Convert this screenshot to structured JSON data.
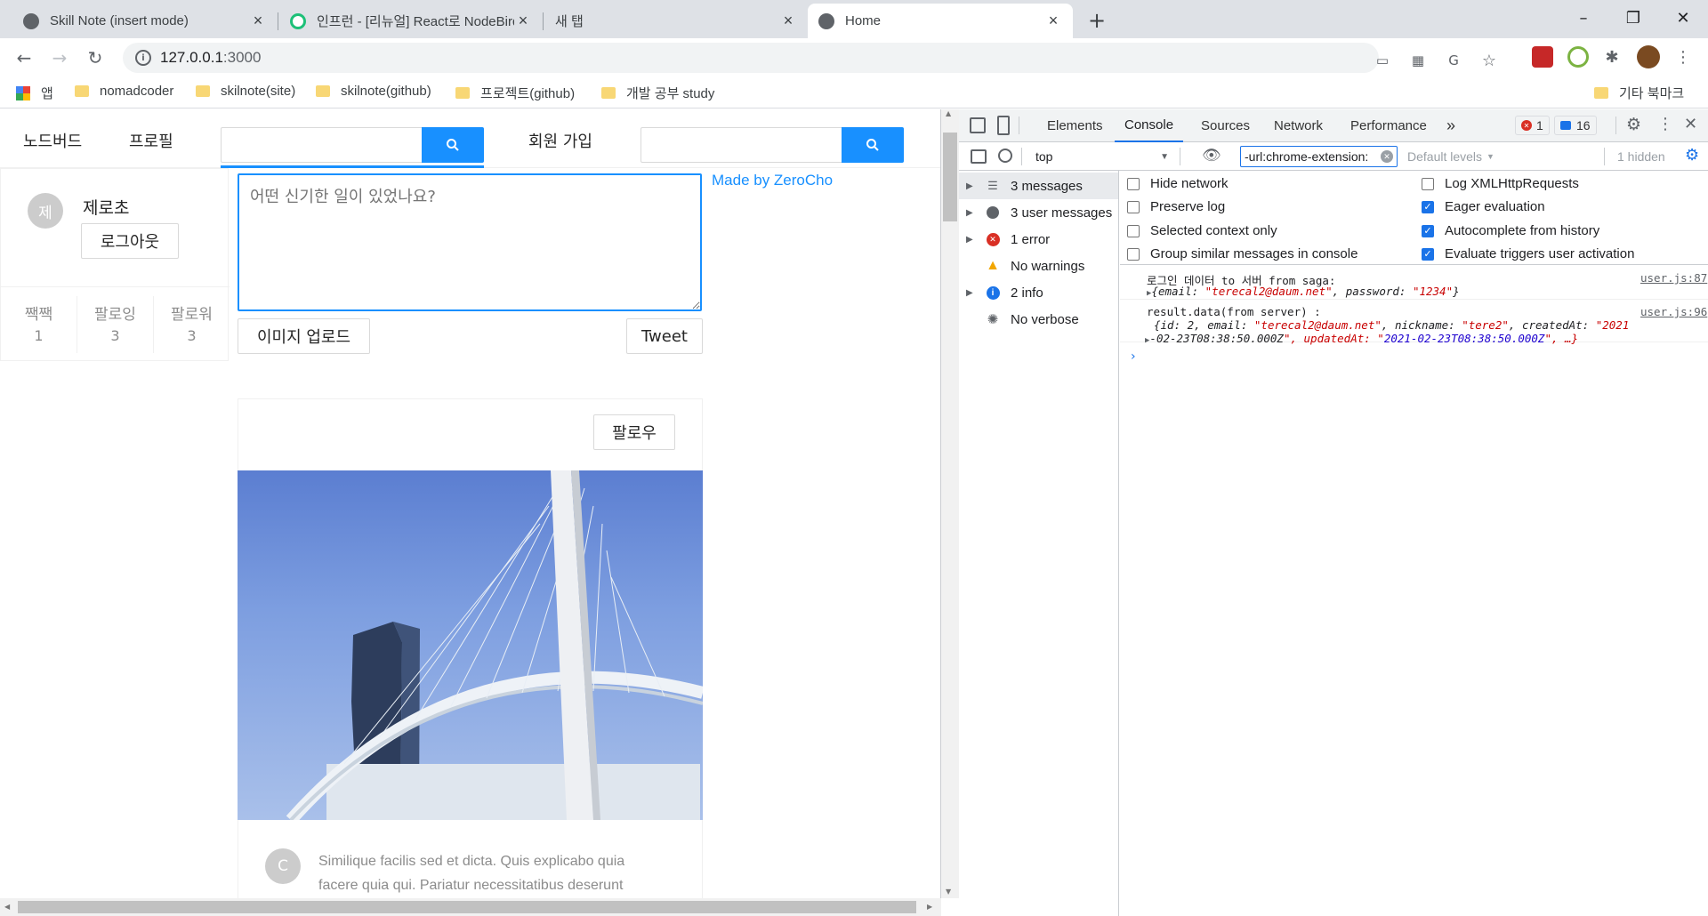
{
  "browser": {
    "tabs": [
      {
        "title": "Skill Note (insert mode)",
        "active": false
      },
      {
        "title": "인프런 - [리뉴얼] React로 NodeBird",
        "active": false
      },
      {
        "title": "새 탭",
        "active": false
      },
      {
        "title": "Home",
        "active": true
      }
    ],
    "url_host": "127.0.0.1",
    "url_port": ":3000",
    "bookmarks": {
      "apps": "앱",
      "items": [
        "nomadcoder",
        "skilnote(site)",
        "skilnote(github)",
        "프로젝트(github)",
        "개발 공부 study"
      ],
      "other": "기타 북마크"
    }
  },
  "app": {
    "menu": {
      "home": "노드버드",
      "profile": "프로필",
      "signup": "회원 가입"
    },
    "user": {
      "avatar_letter": "제",
      "nickname": "제로초",
      "logout_label": "로그아웃"
    },
    "stats": [
      {
        "label": "짹짹",
        "value": "1"
      },
      {
        "label": "팔로잉",
        "value": "3"
      },
      {
        "label": "팔로워",
        "value": "3"
      }
    ],
    "post_form": {
      "placeholder": "어떤 신기한 일이 있었나요?",
      "upload_label": "이미지 업로드",
      "tweet_label": "Tweet"
    },
    "made_by": "Made by ZeroCho",
    "post": {
      "follow_label": "팔로우",
      "author_letter": "C",
      "content_line1": "Similique facilis sed et dicta. Quis explicabo quia",
      "content_line2": "facere quia qui. Pariatur necessitatibus deserunt"
    }
  },
  "devtools": {
    "tabs": [
      "Elements",
      "Console",
      "Sources",
      "Network",
      "Performance"
    ],
    "active_tab": "Console",
    "error_count": "1",
    "message_count": "16",
    "context": "top",
    "filter_value": "-url:chrome-extension:",
    "levels": "Default levels",
    "hidden": "1 hidden",
    "sidebar": [
      {
        "label": "3 messages",
        "icon": "list-icon",
        "color": "#5f6368"
      },
      {
        "label": "3 user messages",
        "icon": "user-icon",
        "color": "#5f6368"
      },
      {
        "label": "1 error",
        "icon": "error-icon",
        "color": "#d93025"
      },
      {
        "label": "No warnings",
        "icon": "warning-icon",
        "color": "#f2a600"
      },
      {
        "label": "2 info",
        "icon": "info-icon",
        "color": "#1a73e8"
      },
      {
        "label": "No verbose",
        "icon": "bug-icon",
        "color": "#5f6368"
      }
    ],
    "settings_left": [
      {
        "label": "Hide network",
        "checked": false
      },
      {
        "label": "Preserve log",
        "checked": false
      },
      {
        "label": "Selected context only",
        "checked": false
      },
      {
        "label": "Group similar messages in console",
        "checked": false
      }
    ],
    "settings_right": [
      {
        "label": "Log XMLHttpRequests",
        "checked": false
      },
      {
        "label": "Eager evaluation",
        "checked": true
      },
      {
        "label": "Autocomplete from history",
        "checked": true
      },
      {
        "label": "Evaluate triggers user activation",
        "checked": true
      }
    ],
    "logs": [
      {
        "text": "로그인 데이터 to 서버 from saga:",
        "source": "user.js:87",
        "obj1": "{email: \"terecal2@daum.net\", password: \"1234\"}"
      },
      {
        "text": "result.data(from server) :",
        "source": "user.js:96",
        "obj1": "{id: 2, email: \"terecal2@daum.net\", nickname: \"tere2\", createdAt: \"2021",
        "obj2": "-02-23T08:38:50.000Z\", updatedAt: \"2021-02-23T08:38:50.000Z\", …}"
      }
    ]
  }
}
